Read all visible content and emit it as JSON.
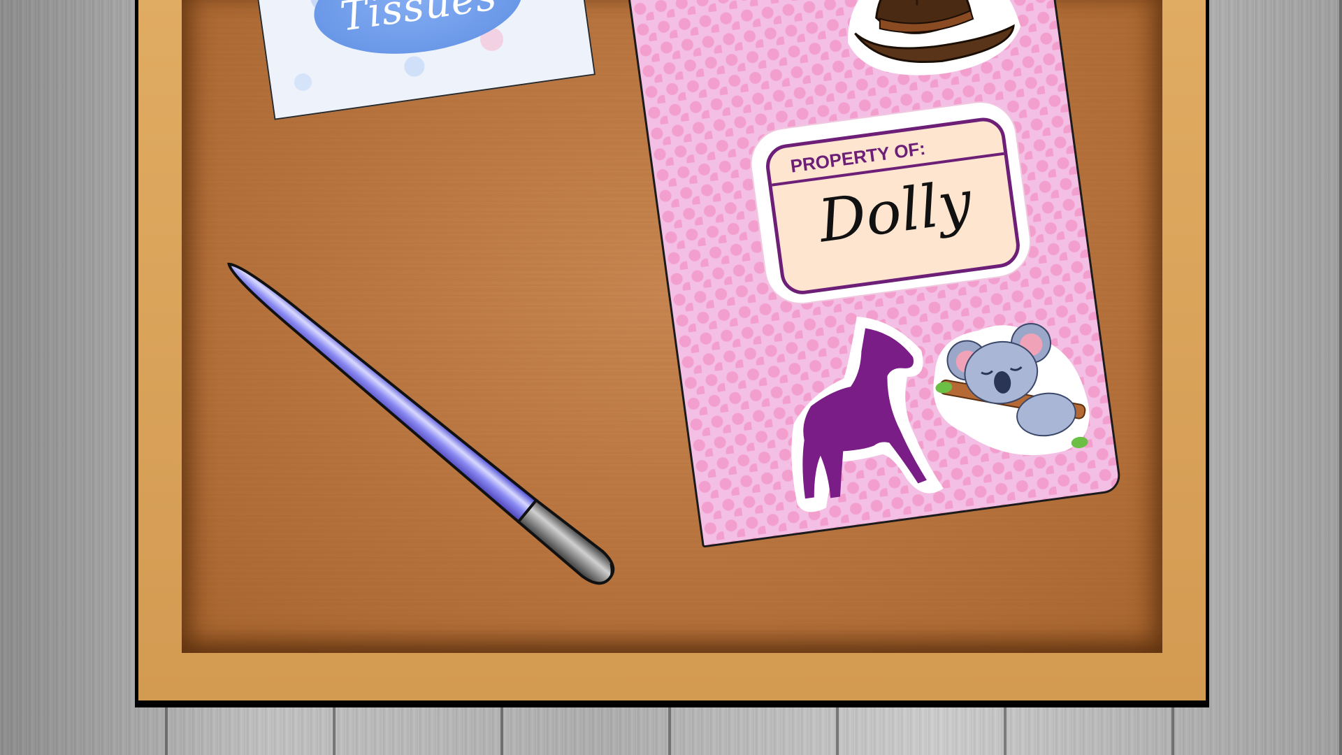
{
  "scene": {
    "tissue_box": {
      "label": "Tissues"
    },
    "notebook": {
      "label_heading": "PROPERTY OF:",
      "owner_name": "Dolly"
    },
    "icons": [
      "cowboy-hat-icon",
      "horse-icon",
      "koala-icon",
      "pen-icon",
      "tissue-box-icon"
    ]
  },
  "colors": {
    "notebook_pink": "#f4bfe4",
    "label_purple": "#6d1f78",
    "pen_blue": "#8f8ff0",
    "tissue_oval": "#6f9cec"
  }
}
